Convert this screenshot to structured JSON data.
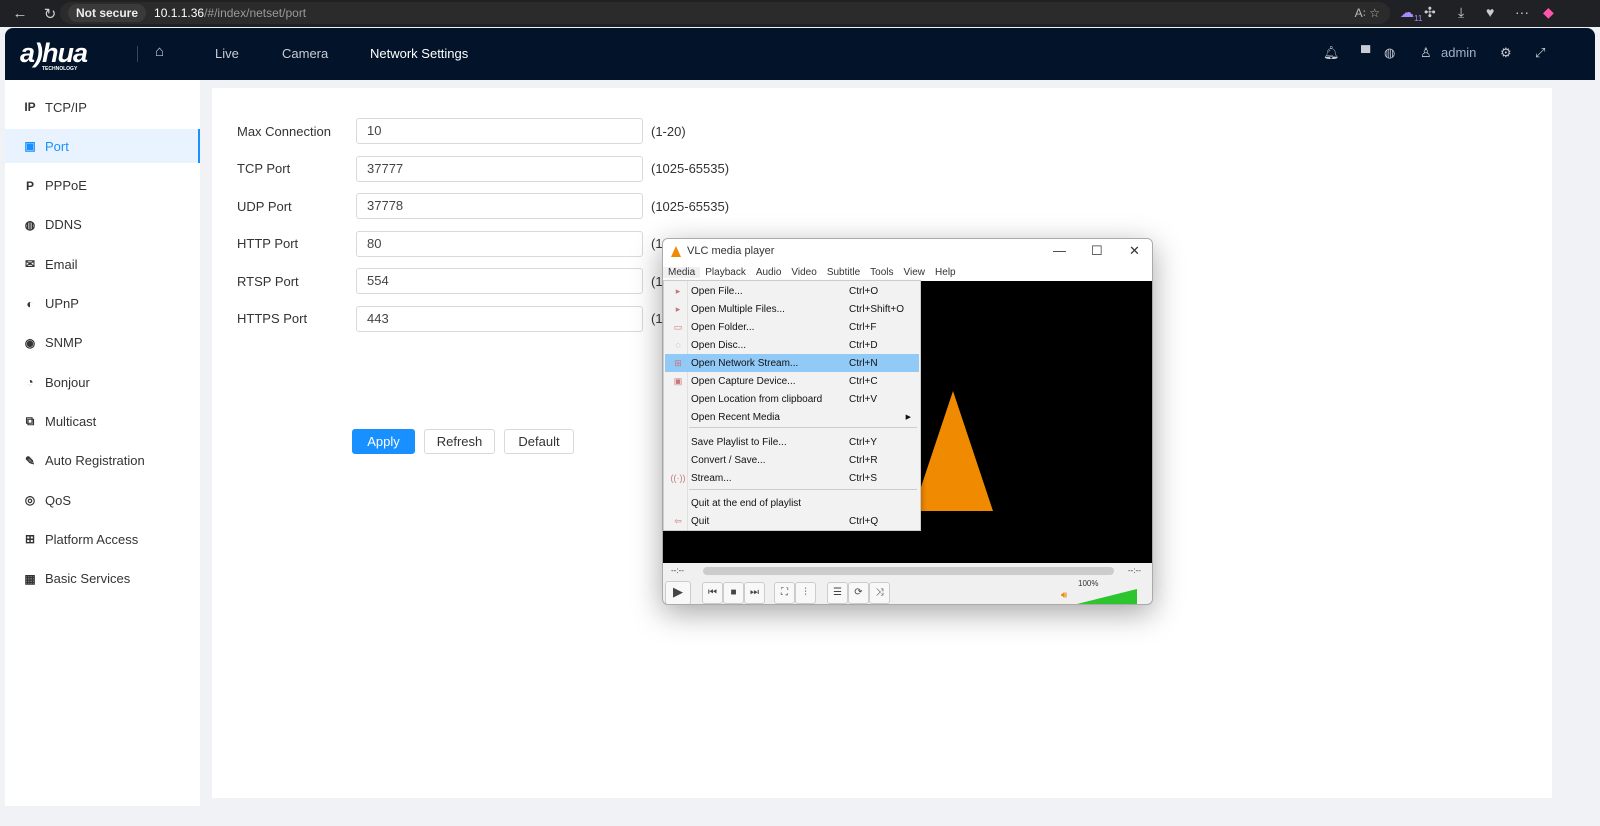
{
  "browser": {
    "not_secure": "Not secure",
    "url_host": "10.1.1.36",
    "url_path": "/#/index/netset/port",
    "ext_badge": "11"
  },
  "header": {
    "logo": "a)hua",
    "logo_sub": "TECHNOLOGY",
    "nav": [
      "Live",
      "Camera",
      "Network Settings"
    ],
    "active_nav": "Network Settings",
    "user": "admin"
  },
  "sidebar": {
    "items": [
      {
        "label": "TCP/IP",
        "icon": "ip-icon"
      },
      {
        "label": "Port",
        "icon": "port-icon",
        "active": true
      },
      {
        "label": "PPPoE",
        "icon": "pppoe-icon"
      },
      {
        "label": "DDNS",
        "icon": "globe-icon"
      },
      {
        "label": "Email",
        "icon": "mail-icon"
      },
      {
        "label": "UPnP",
        "icon": "upnp-icon"
      },
      {
        "label": "SNMP",
        "icon": "snmp-icon"
      },
      {
        "label": "Bonjour",
        "icon": "bonjour-icon"
      },
      {
        "label": "Multicast",
        "icon": "multicast-icon"
      },
      {
        "label": "Auto Registration",
        "icon": "edit-icon"
      },
      {
        "label": "QoS",
        "icon": "qos-icon"
      },
      {
        "label": "Platform Access",
        "icon": "platform-icon"
      },
      {
        "label": "Basic Services",
        "icon": "grid-icon"
      }
    ]
  },
  "form": {
    "fields": [
      {
        "label": "Max Connection",
        "value": "10",
        "range": "(1-20)"
      },
      {
        "label": "TCP Port",
        "value": "37777",
        "range": "(1025-65535)"
      },
      {
        "label": "UDP Port",
        "value": "37778",
        "range": "(1025-65535)"
      },
      {
        "label": "HTTP Port",
        "value": "80",
        "range": "(1"
      },
      {
        "label": "RTSP Port",
        "value": "554",
        "range": "(1"
      },
      {
        "label": "HTTPS Port",
        "value": "443",
        "range": "(1"
      }
    ],
    "apply": "Apply",
    "refresh": "Refresh",
    "default": "Default"
  },
  "vlc": {
    "title": "VLC media player",
    "menus": [
      "Media",
      "Playback",
      "Audio",
      "Video",
      "Subtitle",
      "Tools",
      "View",
      "Help"
    ],
    "items": [
      {
        "label": "Open File...",
        "shortcut": "Ctrl+O"
      },
      {
        "label": "Open Multiple Files...",
        "shortcut": "Ctrl+Shift+O"
      },
      {
        "label": "Open Folder...",
        "shortcut": "Ctrl+F"
      },
      {
        "label": "Open Disc...",
        "shortcut": "Ctrl+D"
      },
      {
        "label": "Open Network Stream...",
        "shortcut": "Ctrl+N",
        "highlighted": true
      },
      {
        "label": "Open Capture Device...",
        "shortcut": "Ctrl+C"
      },
      {
        "label": "Open Location from clipboard",
        "shortcut": "Ctrl+V"
      },
      {
        "label": "Open Recent Media",
        "shortcut": ""
      },
      {
        "label": "Save Playlist to File...",
        "shortcut": "Ctrl+Y"
      },
      {
        "label": "Convert / Save...",
        "shortcut": "Ctrl+R"
      },
      {
        "label": "Stream...",
        "shortcut": "Ctrl+S"
      },
      {
        "label": "Quit at the end of playlist",
        "shortcut": ""
      },
      {
        "label": "Quit",
        "shortcut": "Ctrl+Q"
      }
    ],
    "time_elapsed": "--:--",
    "time_total": "--:--",
    "volume": "100%",
    "volume_level": 1.0
  }
}
